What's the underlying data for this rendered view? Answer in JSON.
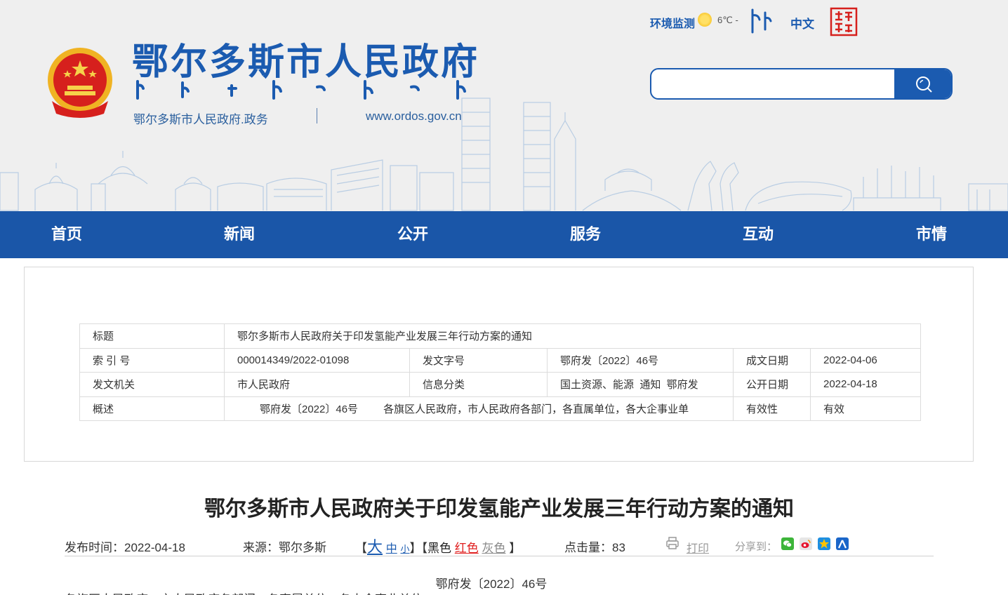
{
  "header": {
    "site_title": "鄂尔多斯市人民政府",
    "subtitle_left": "鄂尔多斯市人民政府.政务",
    "subtitle_right": "www.ordos.gov.cn",
    "env_label": "环境监测",
    "temperature": "6℃ -",
    "lang_zh": "中文",
    "search_placeholder": "",
    "brand_blue": "#1b5bb0"
  },
  "nav": {
    "items": [
      "首页",
      "新闻",
      "公开",
      "服务",
      "互动",
      "市情"
    ],
    "background": "#1a56a8"
  },
  "info": {
    "title_label": "标题",
    "title_value": "鄂尔多斯市人民政府关于印发氢能产业发展三年行动方案的通知",
    "index_label": "索 引 号",
    "index_value": "000014349/2022-01098",
    "docno_label": "发文字号",
    "docno_value": "鄂府发〔2022〕46号",
    "created_label": "成文日期",
    "created_value": "2022-04-06",
    "issuer_label": "发文机关",
    "issuer_value": "市人民政府",
    "category_label": "信息分类",
    "category_value": "国土资源、能源  通知  鄂府发",
    "published_label": "公开日期",
    "published_value": "2022-04-18",
    "summary_label": "概述",
    "summary_part1": "鄂府发〔2022〕46号",
    "summary_part2": "各旗区人民政府，市人民政府各部门，各直属单位，各大企事业单",
    "validity_label": "有效性",
    "validity_value": "有效"
  },
  "article": {
    "title": "鄂尔多斯市人民政府关于印发氢能产业发展三年行动方案的通知",
    "publish_label": "发布时间：2022-04-18",
    "source_label": "来源：鄂尔多斯",
    "bracket_open": "【",
    "size_big": "大",
    "size_mid": "中",
    "size_small": "小",
    "bracket_mid": "】【",
    "color_black": "黑色",
    "color_red": "红色",
    "color_gray": "灰色",
    "bracket_close": "】",
    "hits_label": "点击量：83",
    "print_label": "打印",
    "share_label": "分享到：",
    "doc_number": "鄂府发〔2022〕46号",
    "body_first_line": "各旗区人民政府，市人民政府各部门，各直属单位，各大企事业单位："
  },
  "icons": {
    "search": "search-icon",
    "weather": "sun-icon",
    "print": "printer-icon",
    "share": [
      "wechat-icon",
      "weibo-icon",
      "qzone-icon",
      "renren-icon"
    ]
  }
}
